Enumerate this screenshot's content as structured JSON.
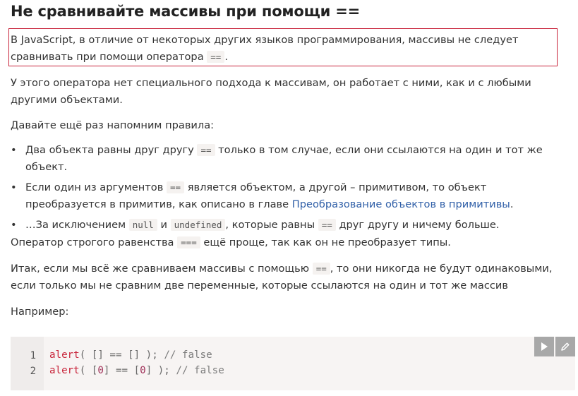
{
  "heading": "Не сравнивайте массивы при помощи ==",
  "highlight": {
    "text_before": "В JavaScript, в отличие от некоторых других языков программирования, массивы не следует сравнивать при помощи оператора",
    "code": "==",
    "text_after": "."
  },
  "para1": "У этого оператора нет специального подхода к массивам, он работает с ними, как и с любыми другими объектами.",
  "para2": "Давайте ещё раз напомним правила:",
  "bullets": [
    {
      "before": "Два объекта равны друг другу",
      "code": "==",
      "after": "только в том случае, если они ссылаются на один и тот же объект."
    },
    {
      "before": "Если один из аргументов",
      "code": "==",
      "middle": "является объектом, а другой – примитивом, то объект преобразуется в примитив, как описано в главе",
      "link": "Преобразование объектов в примитивы",
      "after": "."
    },
    {
      "before": "…За исключением",
      "code1": "null",
      "and": "и",
      "code2": "undefined",
      "middle": ", которые равны",
      "code3": "==",
      "after": "друг другу и ничему больше."
    }
  ],
  "para3": {
    "before": "Оператор строгого равенства",
    "code": "===",
    "after": "ещё проще, так как он не преобразует типы."
  },
  "para4": {
    "before": "Итак, если мы всё же сравниваем массивы с помощью",
    "code": "==",
    "after": ", то они никогда не будут одинаковыми, если только мы не сравним две переменные, которые ссылаются на один и тот же массив"
  },
  "para5": "Например:",
  "code_block": {
    "line_numbers": [
      "1",
      "2"
    ],
    "lines": [
      {
        "fn": "alert",
        "p1": "( [] == [] ); ",
        "comment": "// false"
      },
      {
        "fn": "alert",
        "p1": "( [",
        "num1": "0",
        "p2": "] == [",
        "num2": "0",
        "p3": "] ); ",
        "comment": "// false"
      }
    ]
  },
  "tools": {
    "run_icon": "play-icon",
    "edit_icon": "pencil-icon"
  }
}
